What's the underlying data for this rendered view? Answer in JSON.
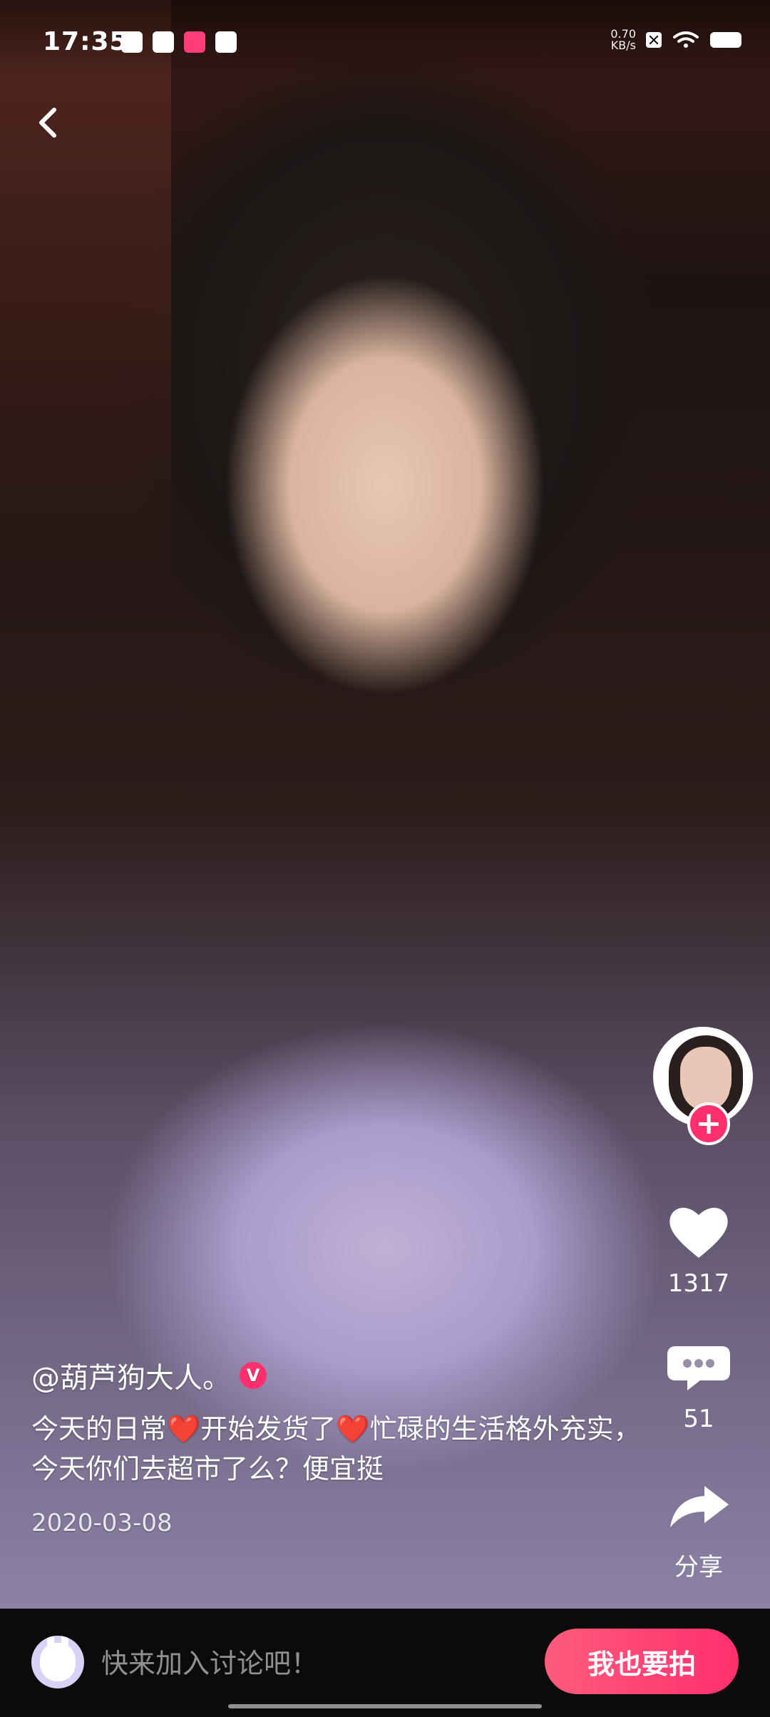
{
  "statusbar": {
    "time": "17:35",
    "network_speed_top": "0.70",
    "network_speed_unit": "KB/s",
    "left_icons": [
      "app-icon-1",
      "app-icon-2",
      "mp-icon",
      "camera-icon"
    ],
    "right_icons": [
      "x-icon",
      "wifi-icon",
      "battery-icon"
    ]
  },
  "video": {
    "user_handle": "@葫芦狗大人。",
    "description": "今天的日常❤️开始发货了❤️忙碌的生活格外充实，今天你们去超市了么？便宜挺",
    "date": "2020-03-08"
  },
  "actions": {
    "likes": "1317",
    "comments": "51",
    "share_label": "分享"
  },
  "bottom": {
    "placeholder": "快来加入讨论吧！",
    "cta": "我也要拍"
  },
  "colors": {
    "accent_pink": "#ff2f6e",
    "button_gradient_start": "#ff5b7c",
    "bottom_bar_bg": "#0b0b0b"
  }
}
